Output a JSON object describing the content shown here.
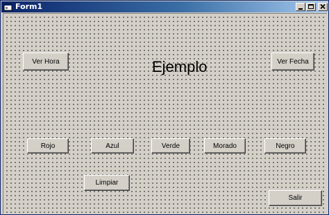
{
  "window": {
    "title": "Form1",
    "controls": {
      "minimize": "minimize-icon",
      "maximize": "maximize-icon",
      "close": "close-icon"
    }
  },
  "form": {
    "heading": "Ejemplo",
    "buttons": {
      "ver_hora": "Ver Hora",
      "ver_fecha": "Ver Fecha",
      "rojo": "Rojo",
      "azul": "Azul",
      "verde": "Verde",
      "morado": "Morado",
      "negro": "Negro",
      "limpiar": "Limpiar",
      "salir": "Salir"
    }
  },
  "colors": {
    "titlebar_start": "#0a246a",
    "titlebar_end": "#a6caf0",
    "face": "#d4d0c8"
  }
}
